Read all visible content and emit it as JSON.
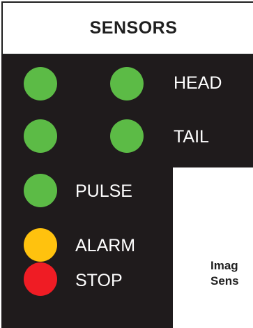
{
  "panel": {
    "title": "SENSORS"
  },
  "colors": {
    "green": "#5cbb46",
    "yellow": "#ffc20e",
    "red": "#ef1c24",
    "background": "#1f1b1c"
  },
  "sensors": [
    {
      "label": "HEAD",
      "status": "green"
    },
    {
      "label": "TAIL",
      "status": "green"
    },
    {
      "label": "PULSE",
      "status": "green"
    },
    {
      "label": "ALARM",
      "status": "yellow"
    },
    {
      "label": "STOP",
      "status": "red"
    }
  ],
  "info_box": {
    "line1": "Imag",
    "line2": "Sens"
  }
}
